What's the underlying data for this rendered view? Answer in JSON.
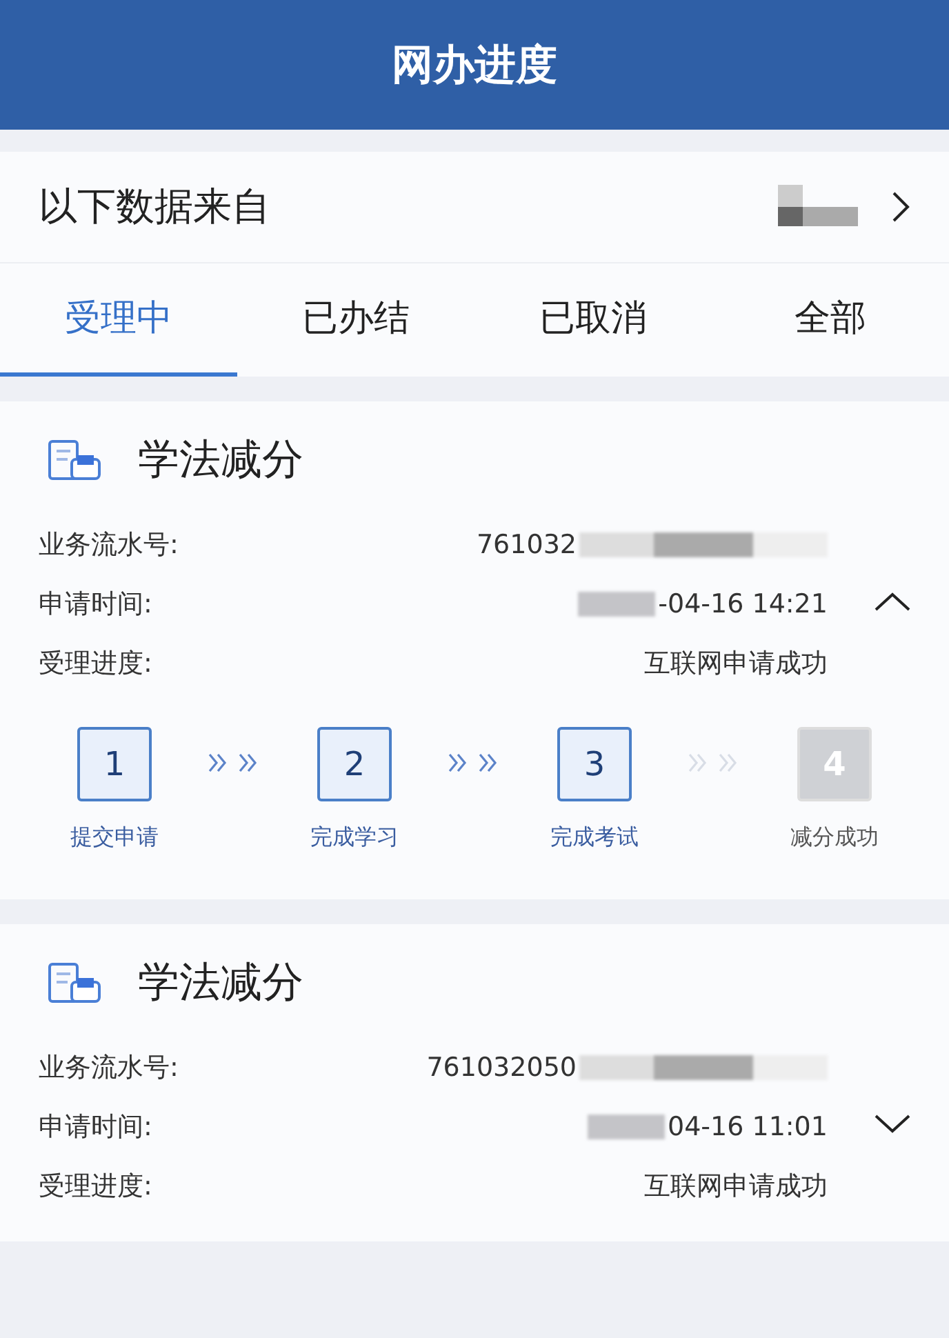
{
  "header": {
    "title": "网办进度"
  },
  "source": {
    "label": "以下数据来自"
  },
  "tabs": [
    {
      "label": "受理中",
      "selected": true
    },
    {
      "label": "已办结",
      "selected": false
    },
    {
      "label": "已取消",
      "selected": false
    },
    {
      "label": "全部",
      "selected": false
    }
  ],
  "cards": [
    {
      "title": "学法减分",
      "expanded": true,
      "rows": [
        {
          "label": "业务流水号:",
          "value": "761032"
        },
        {
          "label": "申请时间:",
          "value": "-04-16 14:21"
        },
        {
          "label": "受理进度:",
          "value": "互联网申请成功"
        }
      ],
      "steps": [
        {
          "number": "1",
          "label": "提交申请",
          "done": true
        },
        {
          "number": "2",
          "label": "完成学习",
          "done": true
        },
        {
          "number": "3",
          "label": "完成考试",
          "done": true
        },
        {
          "number": "4",
          "label": "减分成功",
          "done": false
        }
      ]
    },
    {
      "title": "学法减分",
      "expanded": false,
      "rows": [
        {
          "label": "业务流水号:",
          "value": "761032050"
        },
        {
          "label": "申请时间:",
          "value": "04-16 11:01"
        },
        {
          "label": "受理进度:",
          "value": "互联网申请成功"
        }
      ]
    }
  ]
}
